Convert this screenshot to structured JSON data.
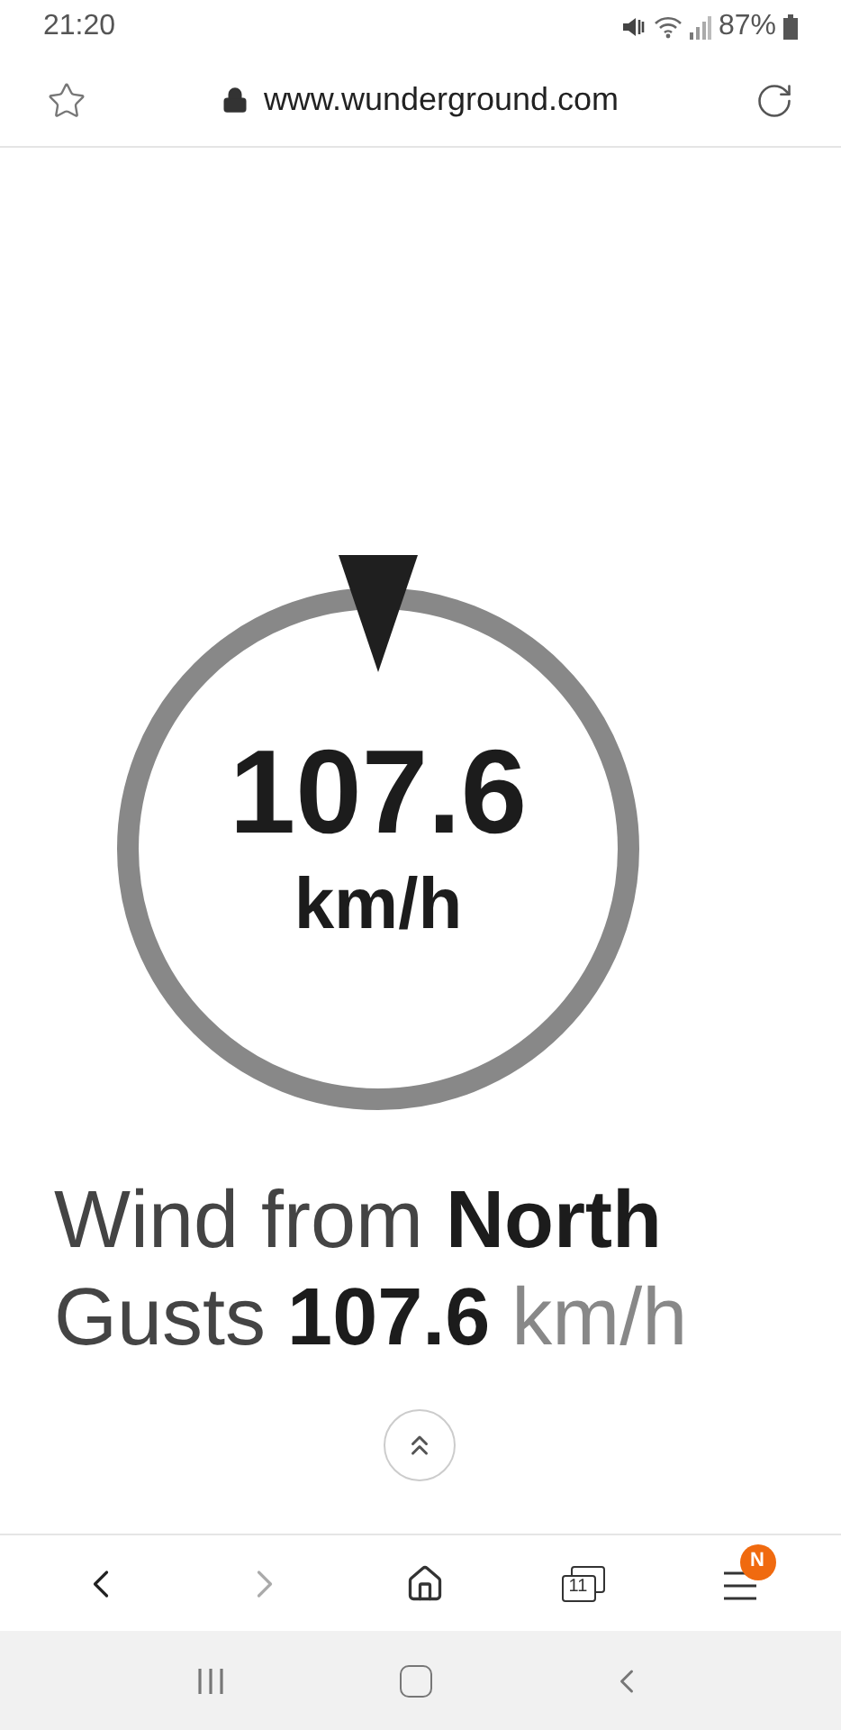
{
  "status_bar": {
    "time": "21:20",
    "battery": "87%"
  },
  "address_bar": {
    "url": "www.wunderground.com"
  },
  "gauge": {
    "value": "107.6",
    "unit": "km/h"
  },
  "wind_line": "Wind from **North**",
  "gusts": {
    "label": "Gusts",
    "value": "107.6",
    "unit": "km/h"
  },
  "toolbar": {
    "tabs_count": "11",
    "menu_badge": "N"
  }
}
